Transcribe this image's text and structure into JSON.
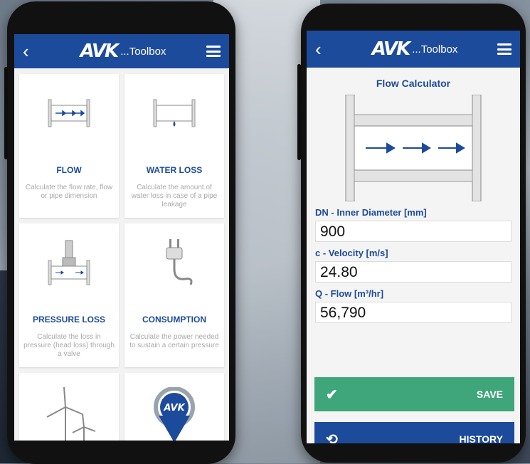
{
  "left_phone": {
    "brand_logo": "AVK",
    "brand_text": "...Toolbox",
    "tiles": [
      {
        "title": "FLOW",
        "desc": "Calculate the flow rate, flow or pipe dimension"
      },
      {
        "title": "WATER LOSS",
        "desc": "Calculate the amount of water loss in case of a pipe leakage"
      },
      {
        "title": "PRESSURE LOSS",
        "desc": "Calculate the loss in pressure (head loss) through a valve"
      },
      {
        "title": "CONSUMPTION",
        "desc": "Calculate the power needed to sustain a certain pressure"
      }
    ]
  },
  "right_phone": {
    "brand_logo": "AVK",
    "brand_text": "...Toolbox",
    "title": "Flow Calculator",
    "fields": [
      {
        "label": "DN - Inner Diameter [mm]",
        "value": "900"
      },
      {
        "label": "c - Velocity [m/s]",
        "value": "24.80"
      },
      {
        "label": "Q - Flow [m³/hr]",
        "value": "56,790"
      }
    ],
    "save_label": "SAVE",
    "history_label": "HISTORY"
  },
  "colors": {
    "brand_blue": "#1d4b9b",
    "save_green": "#3fa57a"
  },
  "icons": [
    "back-arrow-icon",
    "hamburger-menu-icon",
    "pipe-flow-icon",
    "water-leak-icon",
    "valve-icon",
    "power-plug-icon",
    "wind-turbine-icon",
    "avk-pin-icon",
    "check-icon",
    "history-icon"
  ]
}
